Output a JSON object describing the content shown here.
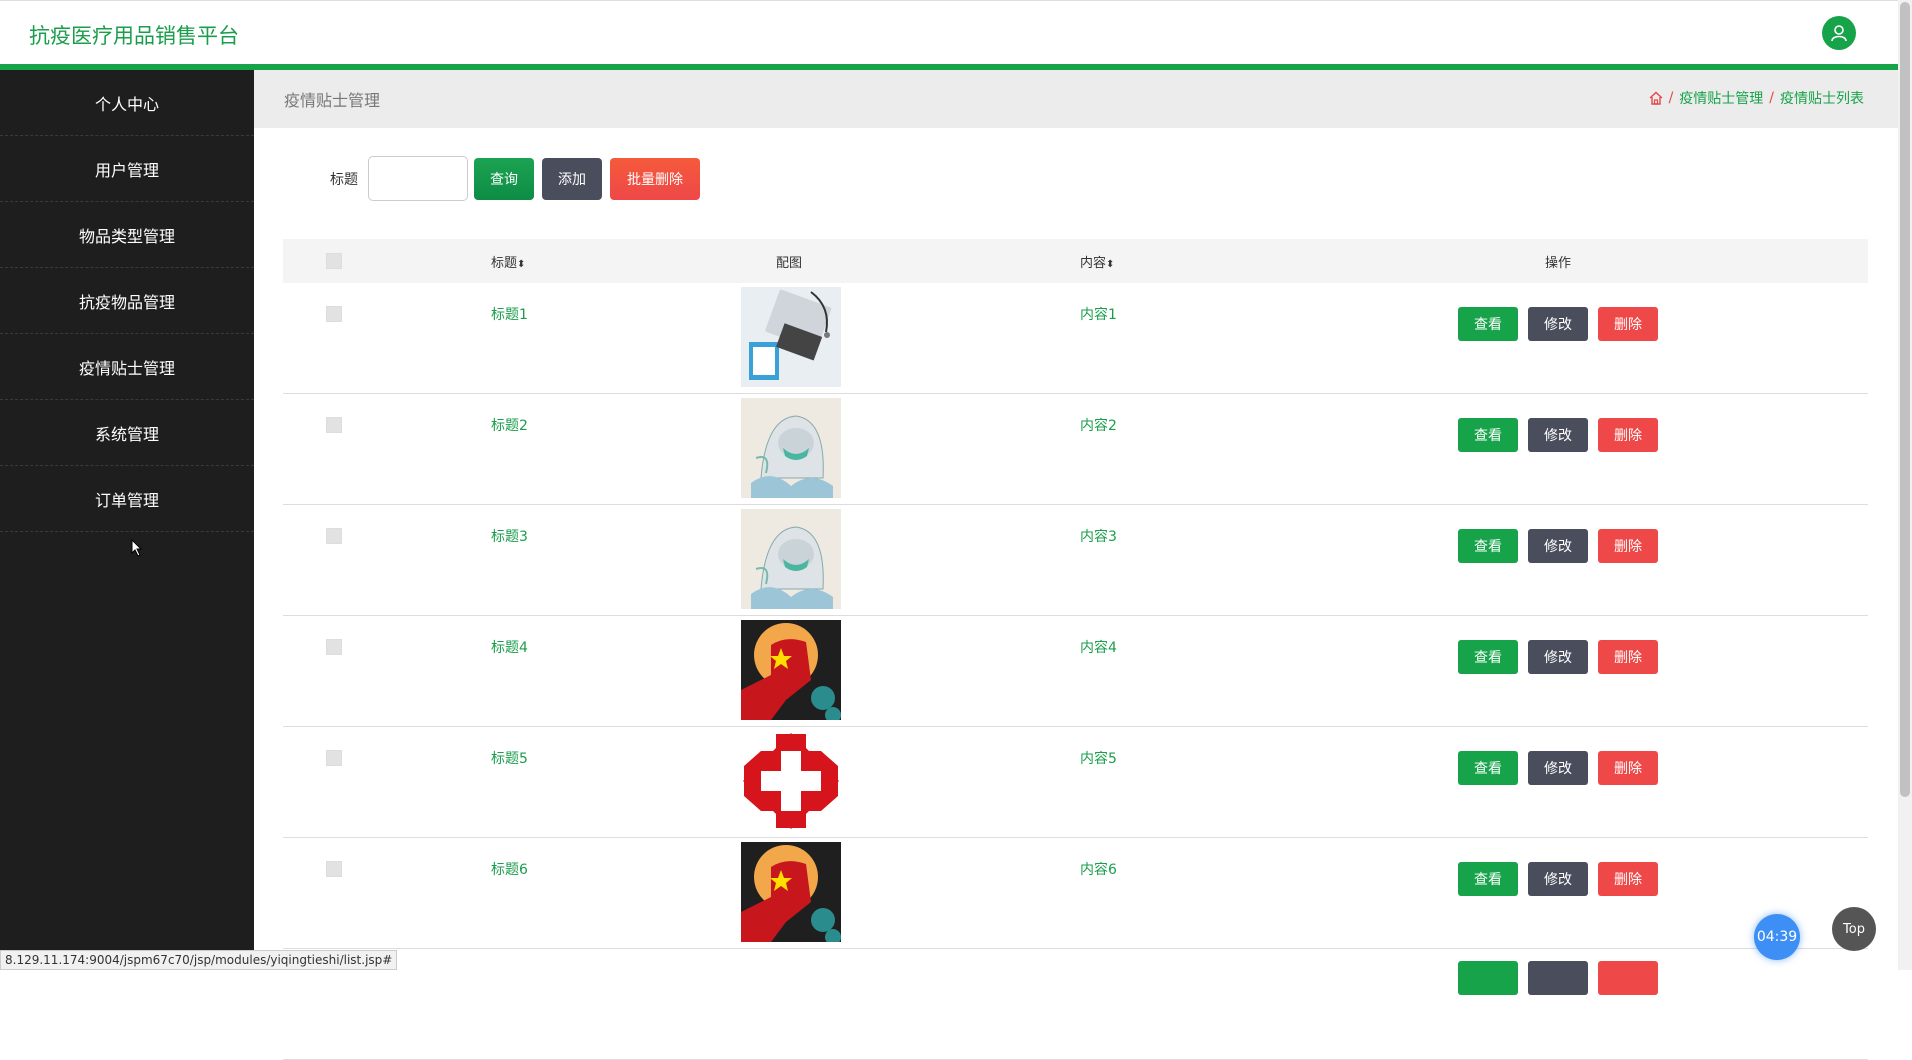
{
  "app": {
    "title": "抗疫医疗用品销售平台"
  },
  "sidebar": {
    "items": [
      {
        "label": "个人中心"
      },
      {
        "label": "用户管理"
      },
      {
        "label": "物品类型管理"
      },
      {
        "label": "抗疫物品管理"
      },
      {
        "label": "疫情贴士管理"
      },
      {
        "label": "系统管理"
      },
      {
        "label": "订单管理"
      }
    ]
  },
  "page": {
    "title": "疫情贴士管理",
    "breadcrumb": [
      "疫情贴士管理",
      "疫情贴士列表"
    ]
  },
  "search": {
    "label": "标题",
    "value": "",
    "query_label": "查询",
    "add_label": "添加",
    "batch_delete_label": "批量删除"
  },
  "table": {
    "headers": {
      "title": "标题",
      "image": "配图",
      "content": "内容",
      "actions": "操作"
    },
    "rows": [
      {
        "title": "标题1",
        "content": "内容1",
        "image": "doctor-laptop"
      },
      {
        "title": "标题2",
        "content": "内容2",
        "image": "masked-medic"
      },
      {
        "title": "标题3",
        "content": "内容3",
        "image": "masked-medic"
      },
      {
        "title": "标题4",
        "content": "内容4",
        "image": "fist-virus"
      },
      {
        "title": "标题5",
        "content": "内容5",
        "image": "red-cross"
      },
      {
        "title": "标题6",
        "content": "内容6",
        "image": "fist-virus"
      }
    ],
    "actions": {
      "view": "查看",
      "edit": "修改",
      "delete": "删除"
    }
  },
  "status_url": "8.129.11.174:9004/jspm67c70/jsp/modules/yiqingtieshi/list.jsp#",
  "timer": "04:39",
  "top_label": "Top",
  "colors": {
    "accent": "#17a34a",
    "dark": "#4a4e5c",
    "danger": "#ee4848",
    "sidebar": "#1e1e1e"
  }
}
